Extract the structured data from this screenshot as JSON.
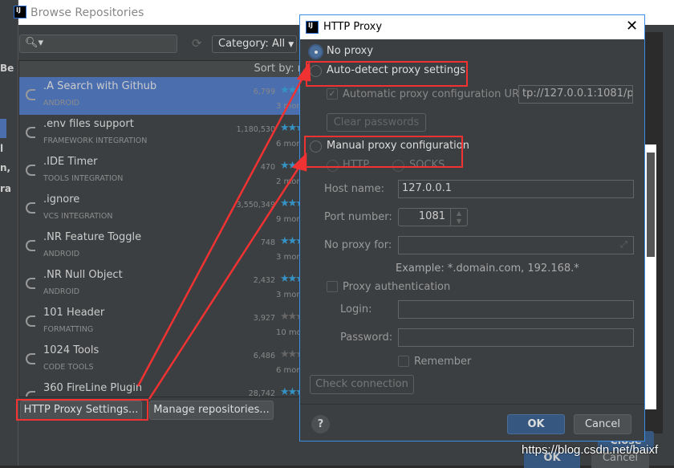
{
  "background": {
    "left_fragments": [
      "Be",
      "l",
      "n,",
      "ra"
    ]
  },
  "browse": {
    "title": "Browse Repositories",
    "search_placeholder": "",
    "category": "Category: All",
    "sort_label": "Sort by: n",
    "plugins": [
      {
        "name": ".A Search with Github",
        "category": "ANDROID",
        "downloads": "6,799",
        "age": "3 mont",
        "rating_color": "blue",
        "selected": true
      },
      {
        "name": ".env files support",
        "category": "FRAMEWORK INTEGRATION",
        "downloads": "1,180,530",
        "age": "6 mont",
        "rating_color": "blue"
      },
      {
        "name": ".IDE Timer",
        "category": "TOOLS INTEGRATION",
        "downloads": "470",
        "age": "2 mont",
        "rating_color": "blue"
      },
      {
        "name": ".ignore",
        "category": "VCS INTEGRATION",
        "downloads": "3,550,349",
        "age": "9 mont",
        "rating_color": "blue"
      },
      {
        "name": ".NR Feature Toggle",
        "category": "ANDROID",
        "downloads": "748",
        "age": "3 mont",
        "rating_color": "blue"
      },
      {
        "name": ".NR Null Object",
        "category": "ANDROID",
        "downloads": "2,432",
        "age": "3 mont",
        "rating_color": "blue"
      },
      {
        "name": "101 Header",
        "category": "FORMATTING",
        "downloads": "3,927",
        "age": "10 mont",
        "rating_color": "grey"
      },
      {
        "name": "1024 Tools",
        "category": "CODE TOOLS",
        "downloads": "6,486",
        "age": "6 mont",
        "rating_color": "grey"
      },
      {
        "name": "360 FireLine Plugin",
        "category": "",
        "downloads": "28,742",
        "age": "",
        "rating_color": "blue"
      }
    ],
    "http_proxy_button": "HTTP Proxy Settings...",
    "manage_repos_button": "Manage repositories...",
    "close_button": "Close",
    "ok_button": "OK",
    "cancel_button": "Cancel"
  },
  "proxy": {
    "title": "HTTP Proxy",
    "no_proxy": "No proxy",
    "auto_detect": "Auto-detect proxy settings",
    "auto_url_label": "Automatic proxy configuration URL:",
    "auto_url_value": "tp://127.0.0.1:1081/pac",
    "clear_passwords": "Clear passwords",
    "manual": "Manual proxy configuration",
    "http": "HTTP",
    "socks": "SOCKS",
    "host_label": "Host name:",
    "host_value": "127.0.0.1",
    "port_label": "Port number:",
    "port_value": "1081",
    "no_proxy_for_label": "No proxy for:",
    "no_proxy_for_value": "",
    "example": "Example: *.domain.com, 192.168.*",
    "proxy_auth": "Proxy authentication",
    "login_label": "Login:",
    "password_label": "Password:",
    "remember": "Remember",
    "check_connection": "Check connection",
    "ok": "OK",
    "cancel": "Cancel",
    "help": "?",
    "selected": "No proxy"
  },
  "watermark": "https://blog.csdn.net/baixf",
  "colors": {
    "accent": "#4b6eaf",
    "annotation": "#f03232",
    "star": "#3592c4"
  }
}
